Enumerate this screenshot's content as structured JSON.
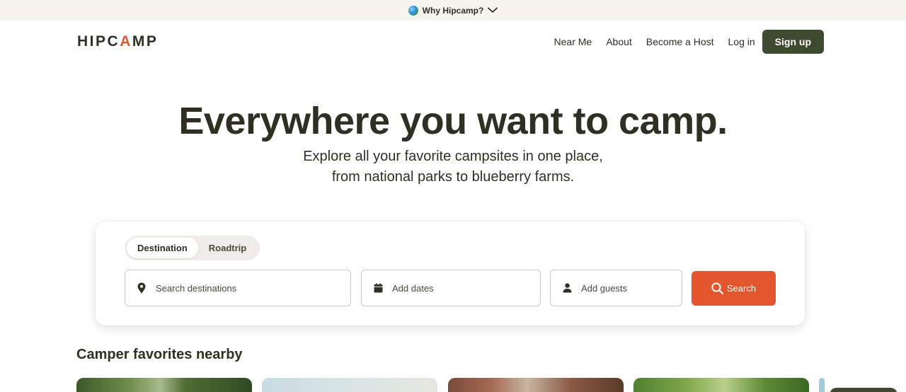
{
  "banner": {
    "label": "Why Hipcamp?",
    "globe_icon": "globe-icon",
    "chevron_icon": "chevron-down-icon"
  },
  "header": {
    "logo": {
      "before": "HIPC",
      "accent": "A",
      "after": "MP"
    },
    "nav": {
      "near_me": "Near Me",
      "about": "About",
      "become_host": "Become a Host",
      "login": "Log in",
      "signup": "Sign up"
    }
  },
  "hero": {
    "title": "Everywhere you want to camp.",
    "subtitle_line1": "Explore all your favorite campsites in one place,",
    "subtitle_line2": "from national parks to blueberry farms."
  },
  "search": {
    "tabs": {
      "destination": "Destination",
      "roadtrip": "Roadtrip",
      "active": "Destination"
    },
    "destination_placeholder": "Search destinations",
    "dates_placeholder": "Add dates",
    "guests_placeholder": "Add guests",
    "button_label": "Search",
    "icons": {
      "destination": "map-pin-icon",
      "dates": "calendar-icon",
      "guests": "person-icon",
      "search": "search-icon"
    }
  },
  "favorites": {
    "title": "Camper favorites nearby"
  },
  "colors": {
    "brand_dark": "#3f4a30",
    "accent": "#e4572e",
    "text": "#2f2f24",
    "banner_bg": "#f6f4ef"
  }
}
